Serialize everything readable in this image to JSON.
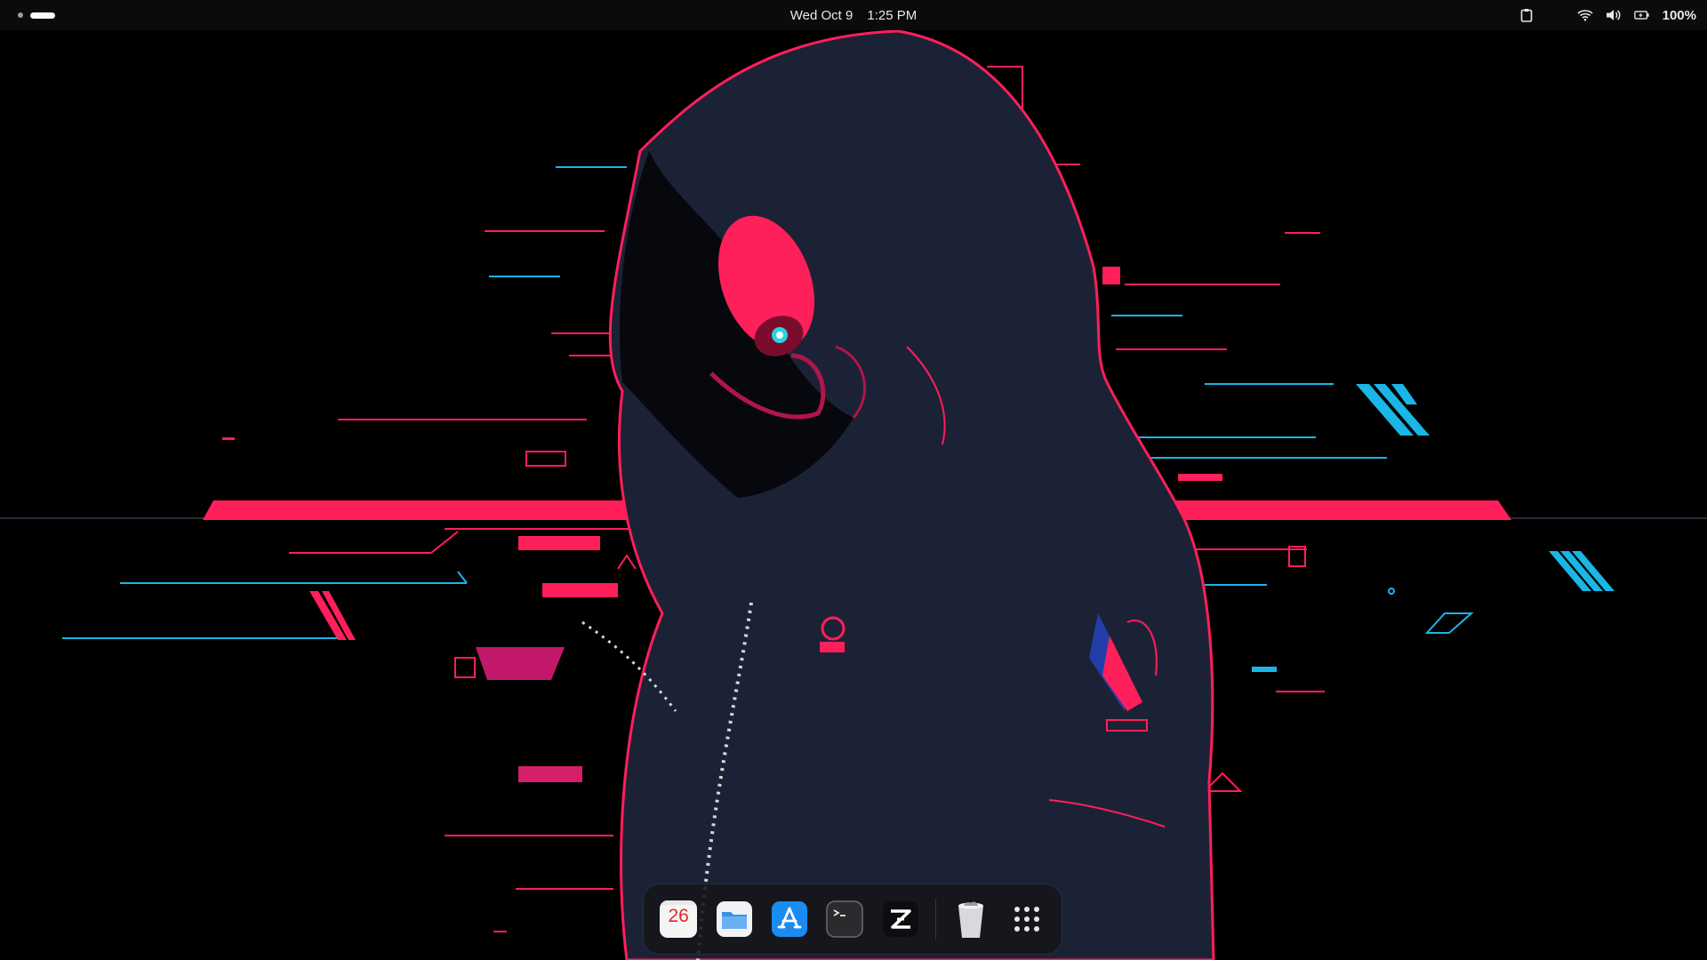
{
  "topbar": {
    "date": "Wed Oct 9",
    "time": "1:25 PM",
    "battery_percent": "100%",
    "icons": [
      "clipboard-icon",
      "wifi-icon",
      "volume-icon",
      "battery-icon"
    ]
  },
  "dock": {
    "calendar_day": "26",
    "apps": [
      "Calendar",
      "Files",
      "App Store",
      "Terminal",
      "Zed",
      "Trash",
      "Show Apps"
    ]
  },
  "colors": {
    "accent_pink": "#ff1f5a",
    "accent_cyan": "#19b6e6",
    "hood": "#1c2236"
  }
}
